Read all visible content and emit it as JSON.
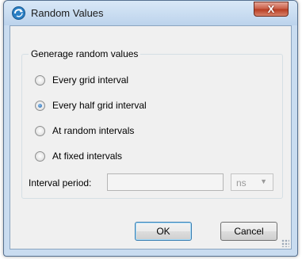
{
  "window": {
    "title": "Random Values",
    "close_glyph": "X",
    "app_icon": "refresh-circle-icon",
    "accent_color": "#1d5fa6"
  },
  "group": {
    "label": "Generage random values",
    "options": [
      {
        "label": "Every grid interval",
        "checked": false
      },
      {
        "label": "Every half grid interval",
        "checked": true
      },
      {
        "label": "At random intervals",
        "checked": false
      },
      {
        "label": "At fixed intervals",
        "checked": false
      }
    ],
    "interval": {
      "label": "Interval period:",
      "value": "",
      "unit": "ns"
    }
  },
  "buttons": {
    "ok": "OK",
    "cancel": "Cancel"
  }
}
